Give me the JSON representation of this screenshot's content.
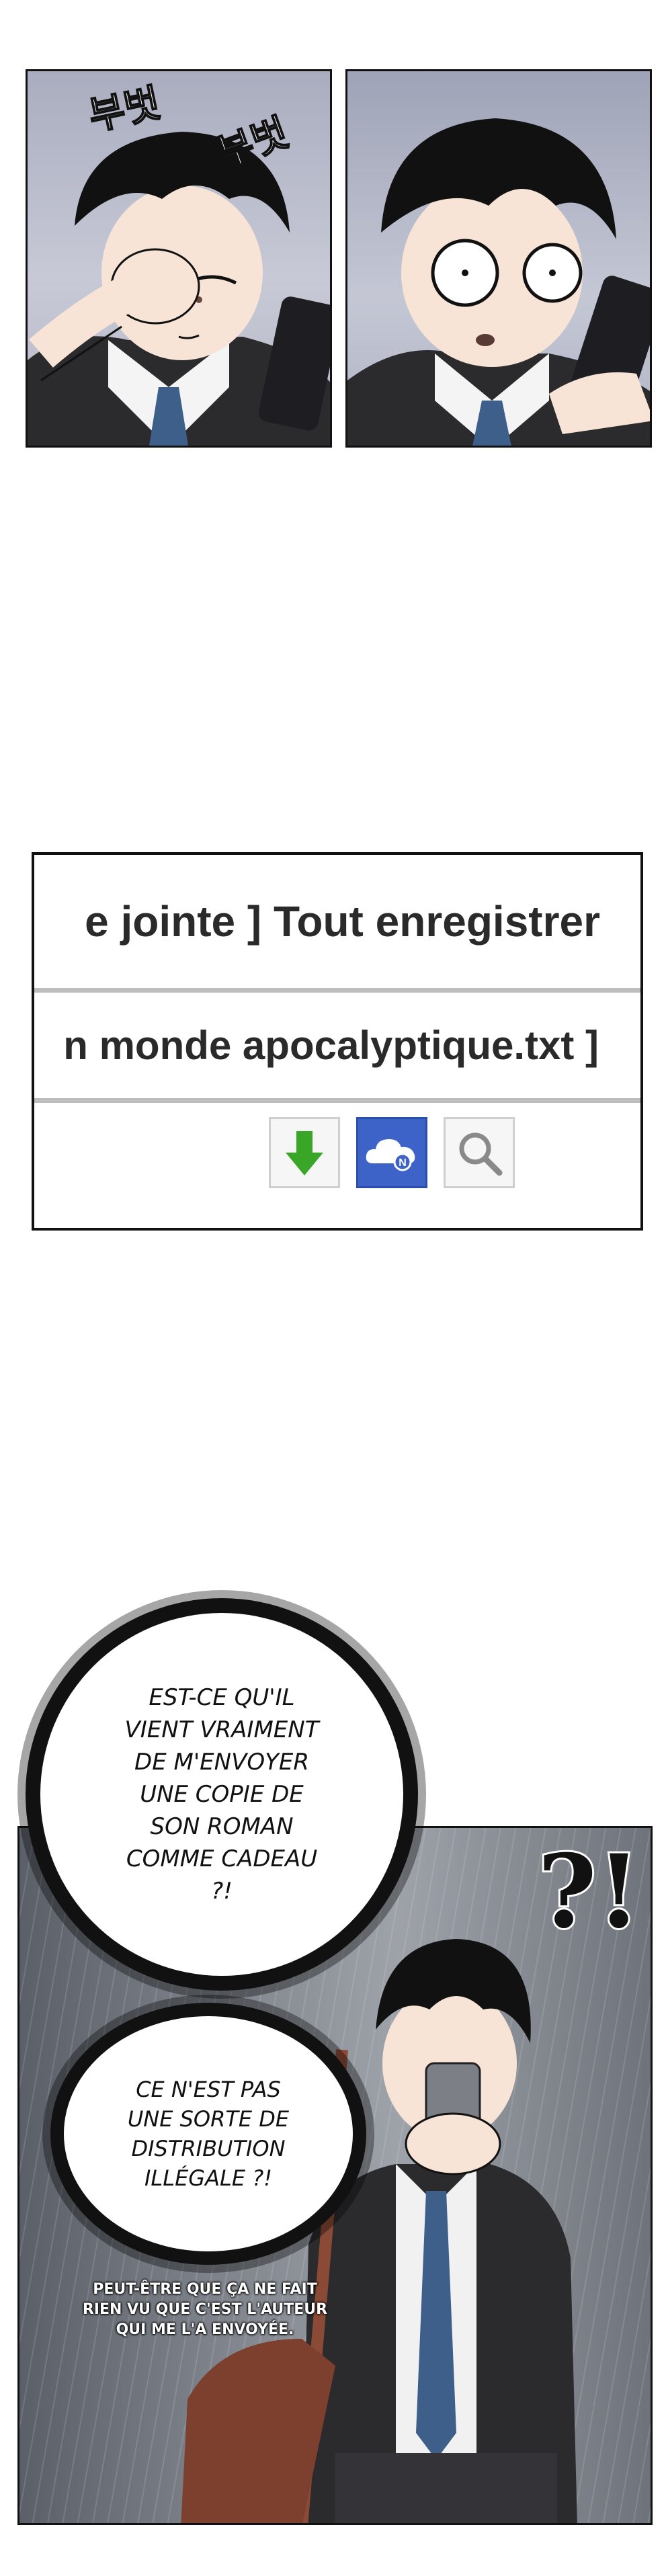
{
  "panel1": {
    "sfx": [
      "부벗",
      "부벗"
    ]
  },
  "filebox": {
    "row1_text": "e jointe ] Tout enregistrer",
    "row2_text": "n monde apocalyptique.txt ]",
    "buttons": [
      {
        "icon": "download-arrow-icon",
        "color": "#3aa628"
      },
      {
        "icon": "cloud-icon",
        "badge": "N",
        "color": "#3d63c8"
      },
      {
        "icon": "search-icon",
        "color": "#8a8a8a"
      }
    ]
  },
  "panel3": {
    "bubble1": "EST-CE QU'IL VIENT VRAIMENT DE M'ENVOYER UNE COPIE DE SON ROMAN COMME CADEAU ?!",
    "bubble2": "CE N'EST PAS UNE SORTE DE DISTRIBUTION ILLÉGALE ?!",
    "caption": "PEUT-ÊTRE QUE ÇA NE FAIT RIEN VU QUE C'EST L'AUTEUR QUI ME L'A ENVOYÉE.",
    "sfx": "?!"
  },
  "colors": {
    "tie": "#3e5f8a",
    "suit": "#2b2b2e",
    "skin": "#f7e4d6"
  }
}
